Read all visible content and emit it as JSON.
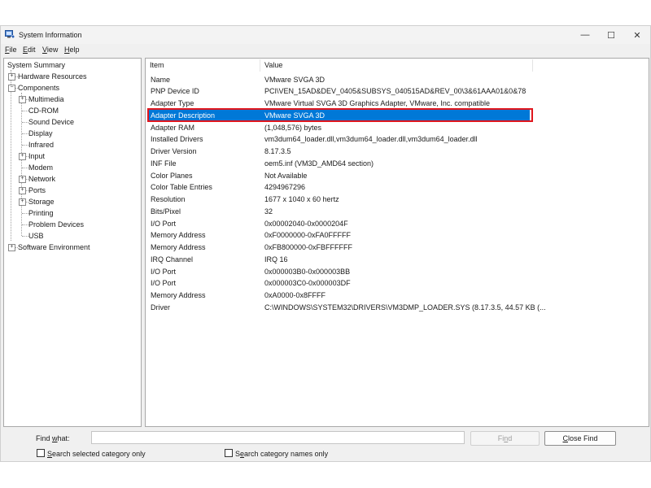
{
  "window": {
    "title": "System Information",
    "icon": "system-information-icon",
    "controls": {
      "minimize": "—",
      "maximize": "☐",
      "close": "✕"
    }
  },
  "menu": [
    {
      "key": "F",
      "rest": "ile"
    },
    {
      "key": "E",
      "rest": "dit"
    },
    {
      "key": "V",
      "rest": "iew"
    },
    {
      "key": "H",
      "rest": "elp"
    }
  ],
  "tree": {
    "root": "System Summary",
    "items": [
      {
        "label": "Hardware Resources",
        "level": 1,
        "expander": "+"
      },
      {
        "label": "Components",
        "level": 1,
        "expander": "−"
      },
      {
        "label": "Multimedia",
        "level": 2,
        "expander": "+"
      },
      {
        "label": "CD-ROM",
        "level": 2,
        "expander": ""
      },
      {
        "label": "Sound Device",
        "level": 2,
        "expander": ""
      },
      {
        "label": "Display",
        "level": 2,
        "expander": ""
      },
      {
        "label": "Infrared",
        "level": 2,
        "expander": ""
      },
      {
        "label": "Input",
        "level": 2,
        "expander": "+"
      },
      {
        "label": "Modem",
        "level": 2,
        "expander": ""
      },
      {
        "label": "Network",
        "level": 2,
        "expander": "+"
      },
      {
        "label": "Ports",
        "level": 2,
        "expander": "+"
      },
      {
        "label": "Storage",
        "level": 2,
        "expander": "+"
      },
      {
        "label": "Printing",
        "level": 2,
        "expander": ""
      },
      {
        "label": "Problem Devices",
        "level": 2,
        "expander": ""
      },
      {
        "label": "USB",
        "level": 2,
        "expander": ""
      },
      {
        "label": "Software Environment",
        "level": 1,
        "expander": "+"
      }
    ]
  },
  "table": {
    "headers": [
      "Item",
      "Value"
    ],
    "selected_index": 3,
    "rows": [
      [
        "Name",
        "VMware SVGA 3D"
      ],
      [
        "PNP Device ID",
        "PCI\\VEN_15AD&DEV_0405&SUBSYS_040515AD&REV_00\\3&61AAA01&0&78"
      ],
      [
        "Adapter Type",
        "VMware Virtual SVGA 3D Graphics Adapter, VMware, Inc. compatible"
      ],
      [
        "Adapter Description",
        "VMware SVGA 3D"
      ],
      [
        "Adapter RAM",
        "(1,048,576) bytes"
      ],
      [
        "Installed Drivers",
        "vm3dum64_loader.dll,vm3dum64_loader.dll,vm3dum64_loader.dll"
      ],
      [
        "Driver Version",
        "8.17.3.5"
      ],
      [
        "INF File",
        "oem5.inf (VM3D_AMD64 section)"
      ],
      [
        "Color Planes",
        "Not Available"
      ],
      [
        "Color Table Entries",
        "4294967296"
      ],
      [
        "Resolution",
        "1677 x 1040 x 60 hertz"
      ],
      [
        "Bits/Pixel",
        "32"
      ],
      [
        "I/O Port",
        "0x00002040-0x0000204F"
      ],
      [
        "Memory Address",
        "0xF0000000-0xFA0FFFFF"
      ],
      [
        "Memory Address",
        "0xFB800000-0xFBFFFFFF"
      ],
      [
        "IRQ Channel",
        "IRQ 16"
      ],
      [
        "I/O Port",
        "0x000003B0-0x000003BB"
      ],
      [
        "I/O Port",
        "0x000003C0-0x000003DF"
      ],
      [
        "Memory Address",
        "0xA0000-0x8FFFF"
      ],
      [
        "Driver",
        "C:\\WINDOWS\\SYSTEM32\\DRIVERS\\VM3DMP_LOADER.SYS (8.17.3.5, 44.57 KB (..."
      ]
    ]
  },
  "find": {
    "label_key": "w",
    "label_pre": "Find ",
    "label_post": "hat:",
    "value": "",
    "find_button_pre": "Fi",
    "find_button_key": "n",
    "find_button_post": "d",
    "close_button_key": "C",
    "close_button_rest": "lose Find",
    "search_selected_key": "S",
    "search_selected_rest": "earch selected category only",
    "search_names_pre": "S",
    "search_names_key": "e",
    "search_names_post": "arch category names only"
  },
  "colors": {
    "selection": "#0078d7",
    "highlight_border": "#e0161d"
  }
}
